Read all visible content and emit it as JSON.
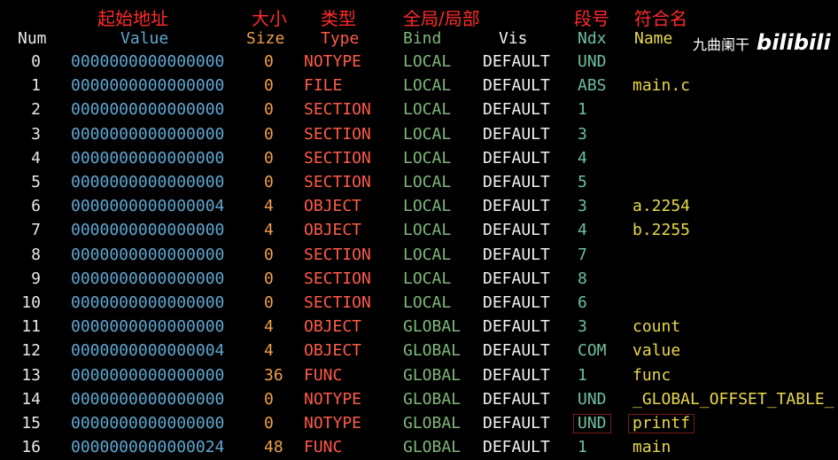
{
  "annotations": {
    "value": "起始地址",
    "size": "大小",
    "type": "类型",
    "bind": "全局/局部",
    "ndx": "段号",
    "name": "符合名"
  },
  "headers": {
    "num": "Num",
    "value": "Value",
    "size": "Size",
    "type": "Type",
    "bind": "Bind",
    "vis": "Vis",
    "ndx": "Ndx",
    "name": "Name"
  },
  "watermark": {
    "text": "九曲阑干",
    "logo": "bilibili"
  },
  "colors": {
    "background": "#000000",
    "annotation": "#ff2a2a",
    "value": "#5fa8d3",
    "size": "#f0a04b",
    "type": "#ff5a4a",
    "bind": "#7fb87a",
    "ndx": "#6cc0a0",
    "name": "#e8d84a"
  },
  "rows": [
    {
      "num": "0",
      "value": "0000000000000000",
      "size": "0",
      "type": "NOTYPE",
      "bind": "LOCAL",
      "vis": "DEFAULT",
      "ndx": "UND",
      "name": ""
    },
    {
      "num": "1",
      "value": "0000000000000000",
      "size": "0",
      "type": "FILE",
      "bind": "LOCAL",
      "vis": "DEFAULT",
      "ndx": "ABS",
      "name": "main.c"
    },
    {
      "num": "2",
      "value": "0000000000000000",
      "size": "0",
      "type": "SECTION",
      "bind": "LOCAL",
      "vis": "DEFAULT",
      "ndx": "1",
      "name": ""
    },
    {
      "num": "3",
      "value": "0000000000000000",
      "size": "0",
      "type": "SECTION",
      "bind": "LOCAL",
      "vis": "DEFAULT",
      "ndx": "3",
      "name": ""
    },
    {
      "num": "4",
      "value": "0000000000000000",
      "size": "0",
      "type": "SECTION",
      "bind": "LOCAL",
      "vis": "DEFAULT",
      "ndx": "4",
      "name": ""
    },
    {
      "num": "5",
      "value": "0000000000000000",
      "size": "0",
      "type": "SECTION",
      "bind": "LOCAL",
      "vis": "DEFAULT",
      "ndx": "5",
      "name": ""
    },
    {
      "num": "6",
      "value": "0000000000000004",
      "size": "4",
      "type": "OBJECT",
      "bind": "LOCAL",
      "vis": "DEFAULT",
      "ndx": "3",
      "name": "a.2254"
    },
    {
      "num": "7",
      "value": "0000000000000000",
      "size": "4",
      "type": "OBJECT",
      "bind": "LOCAL",
      "vis": "DEFAULT",
      "ndx": "4",
      "name": "b.2255"
    },
    {
      "num": "8",
      "value": "0000000000000000",
      "size": "0",
      "type": "SECTION",
      "bind": "LOCAL",
      "vis": "DEFAULT",
      "ndx": "7",
      "name": ""
    },
    {
      "num": "9",
      "value": "0000000000000000",
      "size": "0",
      "type": "SECTION",
      "bind": "LOCAL",
      "vis": "DEFAULT",
      "ndx": "8",
      "name": ""
    },
    {
      "num": "10",
      "value": "0000000000000000",
      "size": "0",
      "type": "SECTION",
      "bind": "LOCAL",
      "vis": "DEFAULT",
      "ndx": "6",
      "name": ""
    },
    {
      "num": "11",
      "value": "0000000000000000",
      "size": "4",
      "type": "OBJECT",
      "bind": "GLOBAL",
      "vis": "DEFAULT",
      "ndx": "3",
      "name": "count"
    },
    {
      "num": "12",
      "value": "0000000000000004",
      "size": "4",
      "type": "OBJECT",
      "bind": "GLOBAL",
      "vis": "DEFAULT",
      "ndx": "COM",
      "name": "value"
    },
    {
      "num": "13",
      "value": "0000000000000000",
      "size": "36",
      "type": "FUNC",
      "bind": "GLOBAL",
      "vis": "DEFAULT",
      "ndx": "1",
      "name": "func"
    },
    {
      "num": "14",
      "value": "0000000000000000",
      "size": "0",
      "type": "NOTYPE",
      "bind": "GLOBAL",
      "vis": "DEFAULT",
      "ndx": "UND",
      "name": "_GLOBAL_OFFSET_TABLE_"
    },
    {
      "num": "15",
      "value": "0000000000000000",
      "size": "0",
      "type": "NOTYPE",
      "bind": "GLOBAL",
      "vis": "DEFAULT",
      "ndx": "UND",
      "name": "printf",
      "highlighted": true
    },
    {
      "num": "16",
      "value": "0000000000000024",
      "size": "48",
      "type": "FUNC",
      "bind": "GLOBAL",
      "vis": "DEFAULT",
      "ndx": "1",
      "name": "main"
    }
  ]
}
